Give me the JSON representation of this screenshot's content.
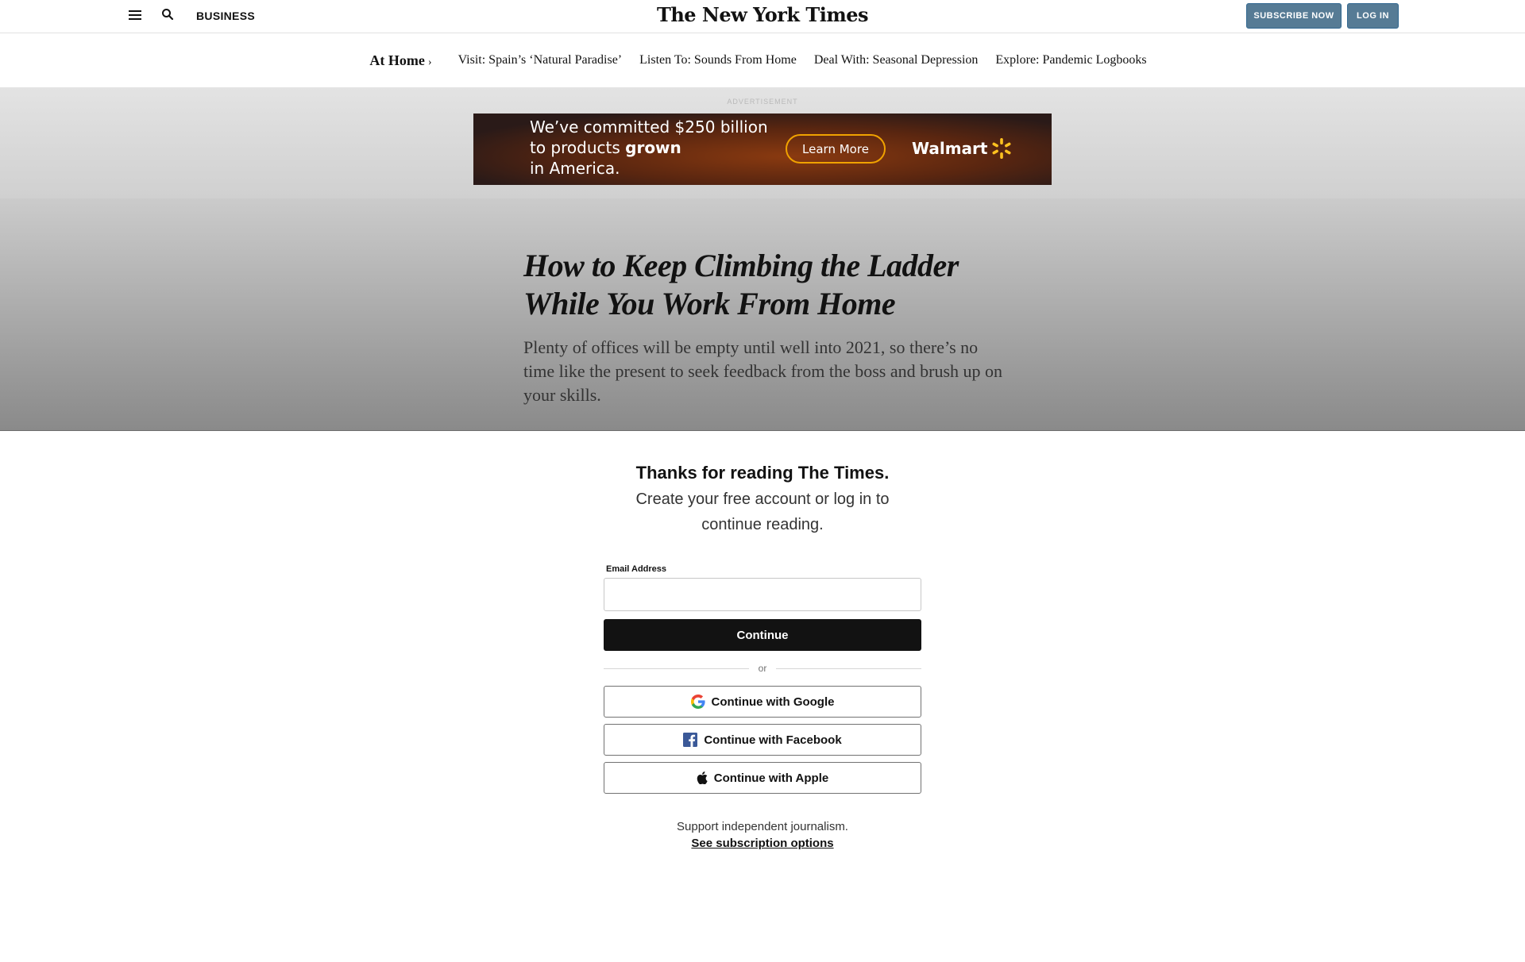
{
  "masthead": {
    "section": "BUSINESS",
    "logo": "The New York Times",
    "subscribe_label": "SUBSCRIBE NOW",
    "login_label": "LOG IN"
  },
  "subnav": {
    "home_label": "At Home",
    "home_chevron": "›",
    "links": [
      "Visit: Spain’s ‘Natural Paradise’",
      "Listen To: Sounds From Home",
      "Deal With: Seasonal Depression",
      "Explore: Pandemic Logbooks"
    ]
  },
  "ad": {
    "label": "ADVERTISEMENT",
    "line1": "We’ve committed $250 billion",
    "line2_a": "to products",
    "line2_b": "grown",
    "line3": "in America.",
    "cta": "Learn More",
    "brand": "Walmart",
    "colors": {
      "accent": "#f0a200"
    }
  },
  "article": {
    "headline": "How to Keep Climbing the Ladder While You Work From Home",
    "summary": "Plenty of offices will be empty until well into 2021, so there’s no time like the present to seek feedback from the boss and brush up on your skills."
  },
  "paywall": {
    "title": "Thanks for reading The Times.",
    "subtitle": "Create your free account or log in to continue reading.",
    "email_label": "Email Address",
    "email_value": "",
    "continue_label": "Continue",
    "or_label": "or",
    "google_label": "Continue with Google",
    "facebook_label": "Continue with Facebook",
    "apple_label": "Continue with Apple",
    "support_text": "Support independent journalism.",
    "subscription_link": "See subscription options"
  },
  "colors": {
    "button_blue": "#567b95",
    "dark": "#121212",
    "facebook": "#3b5998"
  }
}
